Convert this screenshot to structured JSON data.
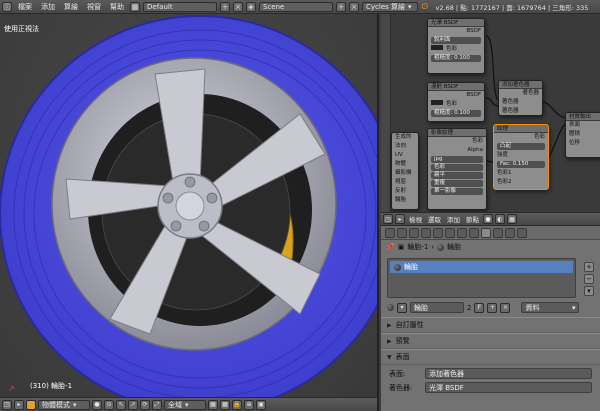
{
  "topbar": {
    "menus": [
      "檔案",
      "添加",
      "算繪",
      "視窗",
      "幫助"
    ],
    "layout": "Default",
    "scene": "Scene",
    "engine": "Cycles 算繪",
    "stats": "v2.68 | 點: 1772167 | 面: 1679764 | 三角形: 335"
  },
  "viewport": {
    "title": "使用正視法",
    "object_label": "(310) 輪胎-1",
    "header": {
      "mode": "物體模式",
      "pivot_space": "全域"
    }
  },
  "node_editor": {
    "nodes": {
      "glossy": {
        "title": "光澤 BSDF",
        "output": "BSDF",
        "dist": "銳利面",
        "color_label": "色彩",
        "rough": "粗糙度: 0.100"
      },
      "diffuse": {
        "title": "漫射 BSDF",
        "output": "BSDF",
        "color_label": "色彩",
        "rough": "粗糙度: 0.100"
      },
      "mix": {
        "title": "添加著色器",
        "out": "著色器",
        "in1": "著色器",
        "in2": "著色器"
      },
      "image": {
        "title": "影像紋理",
        "out_color": "色彩",
        "out_alpha": "Alpha",
        "img": "jpg",
        "color": "色彩",
        "proj": "扁平",
        "ext": "重複",
        "single": "單一影像",
        "vector": "向量"
      },
      "bump": {
        "title": "紋理",
        "out": "色彩",
        "type": "凸起",
        "strength_label": "強度",
        "factor": "Fac: 0.150",
        "color1": "色彩1",
        "color2": "色彩2"
      },
      "output": {
        "title": "材質輸出",
        "surface": "表面",
        "volume": "體積",
        "disp": "位移"
      },
      "coords": {
        "items": [
          "生成的",
          "法向",
          "UV",
          "物體",
          "攝影機",
          "視窗",
          "反射"
        ],
        "label": "輪胎"
      }
    },
    "header": {
      "menus": [
        "檢視",
        "選取",
        "添加",
        "節點"
      ]
    }
  },
  "properties": {
    "breadcrumb_obj": "輪胎-1",
    "breadcrumb_mat": "輪胎",
    "slot_selected": "輪胎",
    "material_name": "輪胎",
    "users": "2",
    "fake": "F",
    "link": "資料",
    "sections": [
      {
        "label": "自訂屬性",
        "open": false
      },
      {
        "label": "預覽",
        "open": false
      },
      {
        "label": "表面",
        "open": true
      }
    ],
    "surface_label": "表面:",
    "surface_value": "添加著色器",
    "next_label": "著色器:",
    "next_value": "光澤 BSDF"
  }
}
